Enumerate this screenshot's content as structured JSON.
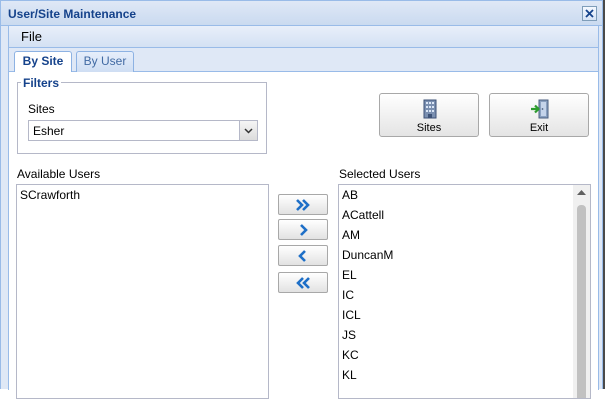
{
  "window": {
    "title": "User/Site Maintenance"
  },
  "menu": {
    "file": "File"
  },
  "tabs": [
    {
      "label": "By Site",
      "active": true
    },
    {
      "label": "By User",
      "active": false
    }
  ],
  "filters": {
    "legend": "Filters",
    "sites_label": "Sites",
    "sites_value": "Esher"
  },
  "buttons": {
    "sites": "Sites",
    "exit": "Exit"
  },
  "available_users": {
    "label": "Available Users",
    "items": [
      "SCrawforth"
    ]
  },
  "selected_users": {
    "label": "Selected Users",
    "items": [
      "AB",
      "ACattell",
      "AM",
      "DuncanM",
      "EL",
      "IC",
      "ICL",
      "JS",
      "KC",
      "KL"
    ]
  },
  "move_buttons": [
    "move-all-right",
    "move-right",
    "move-left",
    "move-all-left"
  ],
  "colors": {
    "accent": "#15428b",
    "frame": "#99bbe8",
    "arrow": "#1e6fc7"
  }
}
